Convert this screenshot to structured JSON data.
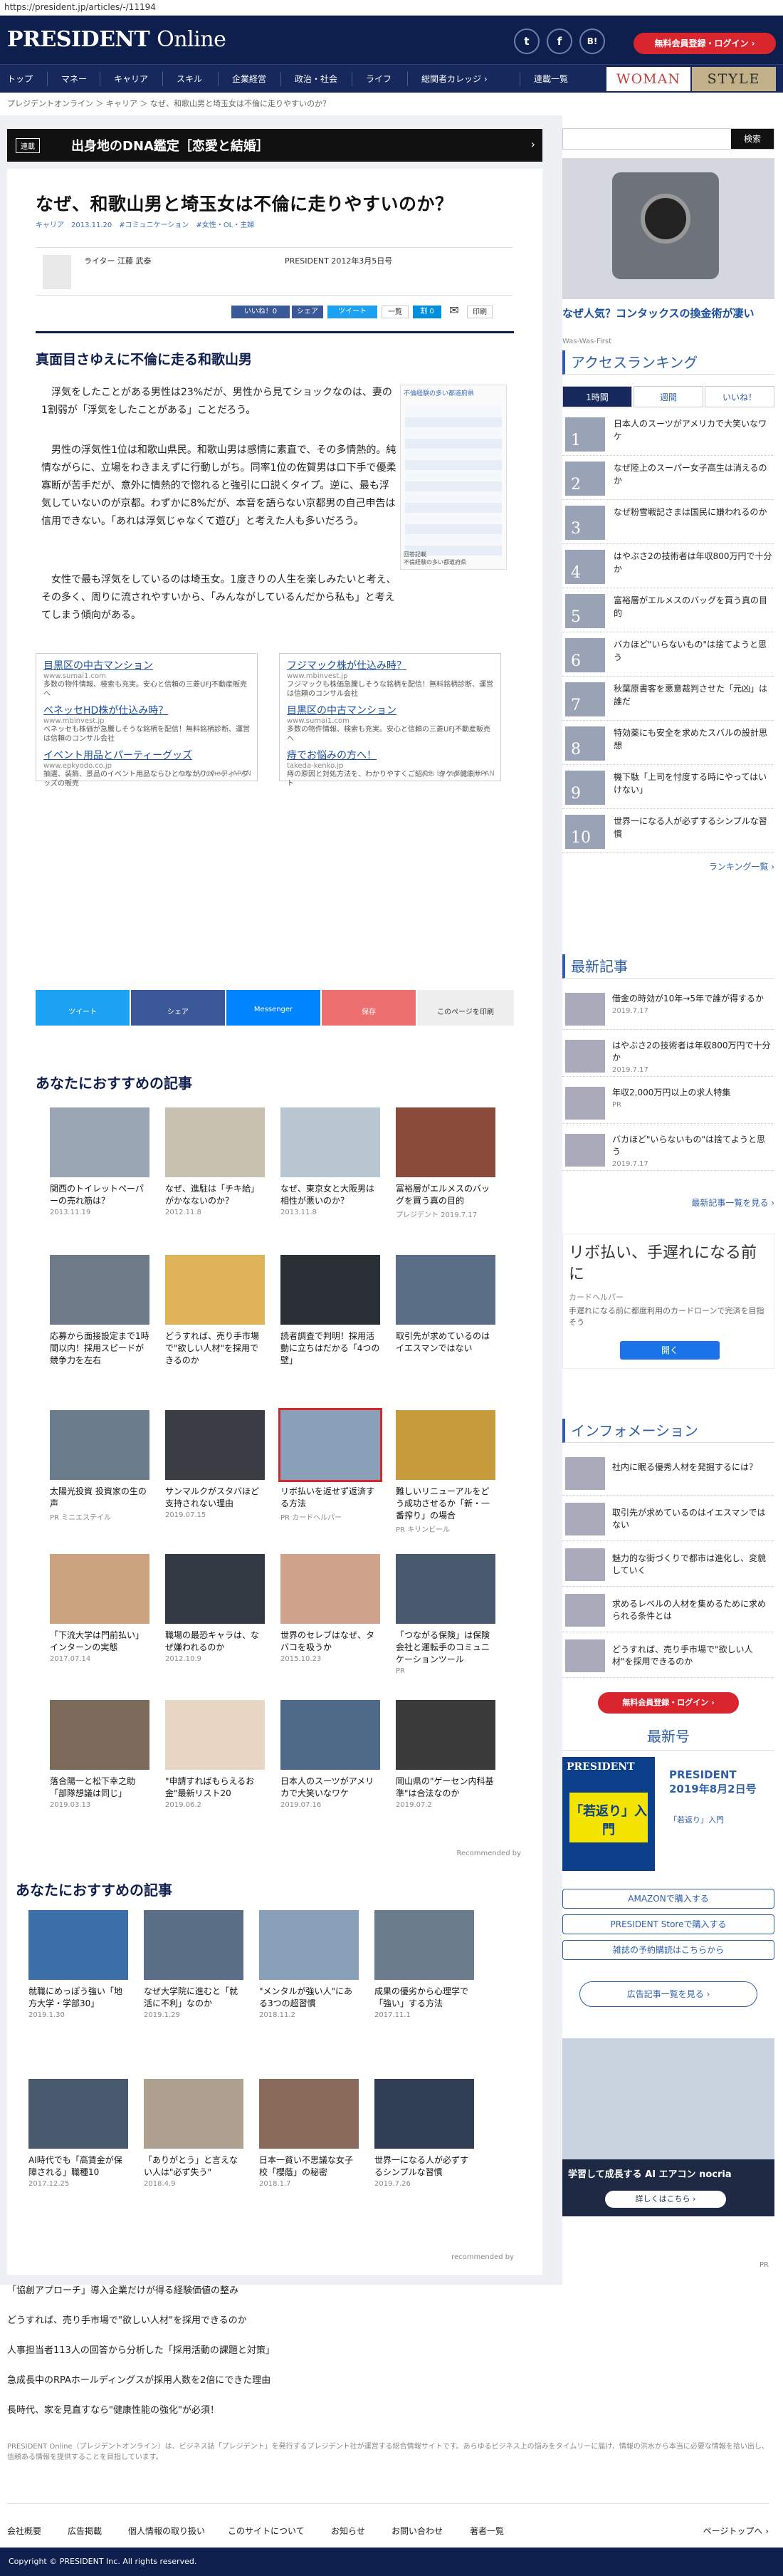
{
  "browser": {
    "url": "https://president.jp/articles/-/11194"
  },
  "header": {
    "logo_bold": "PRESIDENT",
    "logo_light": "Online",
    "social": [
      "t",
      "f",
      "B!"
    ],
    "register_login": "無料会員登録・ログイン ›"
  },
  "nav": {
    "items": [
      "トップ",
      "マネー",
      "キャリア",
      "スキル",
      "企業経営",
      "政治・社会",
      "ライフ",
      "総関者カレッジ ›",
      "連載一覧"
    ],
    "woman": "WOMAN",
    "style": "STYLE"
  },
  "breadcrumb": "プレジデントオンライン ＞ キャリア ＞ なぜ、和歌山男と埼玉女は不倫に走りやすいのか？",
  "article": {
    "series_tag": "連載",
    "series_title": "出身地のDNA鑑定［恋愛と結婚］",
    "title": "なぜ、和歌山男と埼玉女は不倫に走りやすいのか？",
    "meta": "キャリア　2013.11.20　#コミュニケーション　#女性・OL・主婦",
    "author": "ライター 江藤 武泰",
    "pub": "PRESIDENT 2012年3月5日号",
    "shares": [
      "いいね！0",
      "シェア",
      "ツイート",
      "一覧",
      "割 0",
      "✉",
      "印刷"
    ],
    "subhead": "真面目さゆえに不倫に走る和歌山男",
    "paragraphs": [
      "浮気をしたことがある男性は23%だが、男性から見てショックなのは、妻の1割弱が「浮気をしたことがある」ことだろう。",
      "男性の浮気性1位は和歌山県民。和歌山男は感情に素直で、その多情熱的。純情ながらに、立場をわきまえずに行動しがち。同率1位の佐賀男は口下手で優柔寡断が苦手だが、意外に情熱的で惚れると強引に口説くタイプ。逆に、最も浮気していないのが京都。わずかに8%だが、本音を語らない京都男の自己申告は信用できない。「あれは浮気じゃなくて遊び」と考えた人も多いだろう。",
      "女性で最も浮気をしているのは埼玉女。1度きりの人生を楽しみたいと考え、その多く、周りに流されやすいから、「みんながしているんだから私も」と考えてしまう傾向がある。"
    ],
    "figure_title": "不倫経験の多い都道府県",
    "figure_caption": "回答記載\n不倫経験の多い都道府県",
    "ads": [
      {
        "links": [
          "目黒区の中古マンション",
          "ベネッセHD株が仕込み時？",
          "イベント用品とパーティーグッズ"
        ],
        "urls": [
          "www.sumai1.com",
          "www.mbinvest.jp",
          "www.epkyodo.co.jp"
        ],
        "descs": [
          "多数の物件情報、検索も充実。安心と信頼の三菱UFJ不動産販売へ",
          "ベネッセも株価が急騰しそうな銘柄を配信！無料銘柄診断、運営は信頼のコンサル会社",
          "抽選、装飾、景品のイベント用品ならひとつながりパーティーグッズの販売"
        ],
        "foot": "Ads by Yahoo! JAPAN"
      },
      {
        "links": [
          "フジマック株が仕込み時？",
          "目黒区の中古マンション",
          "痔でお悩みの方へ！"
        ],
        "urls": [
          "www.mbinvest.jp",
          "www.sumai1.com",
          "takeda-kenko.jp"
        ],
        "descs": [
          "フジマックも株価急騰しそうな銘柄を配信！無料銘柄診断、運営は信頼のコンサル会社",
          "多数の物件情報、検索も充実。安心と信頼の三菱UFJ不動産販売へ",
          "痔の原因と対処方法を、わかりやすくご紹介！ タケダ健康サイト"
        ],
        "foot": "Ads by Yahoo! JAPAN"
      }
    ],
    "sharebar": [
      "ツイート",
      "シェア",
      "Messenger",
      "保存",
      "このページを印刷"
    ]
  },
  "recommend1": {
    "title": "あなたにおすすめの記事",
    "cards": [
      {
        "t": "関西のトイレットペーパーの売れ筋は？",
        "d": "2013.11.19"
      },
      {
        "t": "なぜ、進駐は「チキ給」がかなないのか？",
        "d": "2012.11.8"
      },
      {
        "t": "なぜ、東京女と大阪男は相性が悪いのか？",
        "d": "2013.11.8"
      },
      {
        "t": "冨裕層がエルメスのバッグを買う真の目的",
        "d": "プレジデント 2019.7.17"
      },
      {
        "t": "応募から面接設定まで1時間以内！採用スピードが競争力を左右",
        "d": ""
      },
      {
        "t": "どうすれば、売り手市場で\"欲しい人材\"を採用できるのか",
        "d": ""
      },
      {
        "t": "読者調査で判明！採用活動に立ちはだかる「4つの壁」",
        "d": ""
      },
      {
        "t": "取引先が求めているのはイエスマンではない",
        "d": ""
      },
      {
        "t": "太陽光投資 投資家の生の声",
        "d": "PR ミニエステイル"
      },
      {
        "t": "サンマルクがスタバほど支持されない理由",
        "d": "2019.07.15"
      },
      {
        "t": "リボ払いを返せず返済する方法",
        "d": "PR カードヘルパー"
      },
      {
        "t": "難しいリニューアルをどう成功させるか「新・一番搾り」の場合",
        "d": "PR キリンビール"
      },
      {
        "t": "「下流大学は門前払い」インターンの実態",
        "d": "2017.07.14"
      },
      {
        "t": "職場の最恐キャラは、なぜ嫌われるのか",
        "d": "2012.10.9"
      },
      {
        "t": "世界のセレブはなぜ、タバコを吸うか",
        "d": "2015.10.23"
      },
      {
        "t": "「つながる保険」は保険会社と運転手のコミュニケーションツール",
        "d": "PR"
      },
      {
        "t": "落合陽一と松下幸之助「部隊想議は同じ」",
        "d": "2019.03.13"
      },
      {
        "t": "\"申請すればもらえるお金\"最新リスト20",
        "d": "2019.06.2"
      },
      {
        "t": "日本人のスーツがアメリカで大笑いなワケ",
        "d": "2019.07.16"
      },
      {
        "t": "岡山県の\"ゲーセン内科基準\"は合法なのか",
        "d": "2019.07.2"
      }
    ],
    "credit": "Recommended by"
  },
  "recommend2": {
    "title": "あなたにおすすめの記事",
    "cards": [
      {
        "t": "就職にめっぽう強い「地方大学・学部30」",
        "d": "2019.1.30"
      },
      {
        "t": "なぜ大学院に進むと「就活に不利」なのか",
        "d": "2019.1.29"
      },
      {
        "t": "\"メンタルが強い人\"にある3つの超習慣",
        "d": "2018.11.2"
      },
      {
        "t": "成果の優劣から心理学で「強い」する方法",
        "d": "2017.11.1"
      },
      {
        "t": "AI時代でも「高賃金が保障される」職種10",
        "d": "2017.12.25"
      },
      {
        "t": "「ありがとう」と言えない人は\"必ず失う\"",
        "d": "2018.4.9"
      },
      {
        "t": "日本一貧い不思議な女子校「櫻蔭」の秘密",
        "d": "2018.1.7"
      },
      {
        "t": "世界一になる人が必ずするシンプルな習慣",
        "d": "2019.7.26"
      }
    ],
    "credit": "recommended by"
  },
  "sidebar": {
    "search_btn": "検索",
    "ad_caption": "なぜ人気？コンタックスの換金術が凄い",
    "ad_source": "Was-Was-First",
    "ranking_title": "アクセスランキング",
    "tabs": [
      "1時間",
      "週間",
      "いいね！"
    ],
    "ranking": [
      "日本人のスーツがアメリカで大笑いなワケ",
      "なぜ陸上のスーパー女子高生は消えるのか",
      "なぜ粉雪戦記さまは国民に嫌われるのか",
      "はやぶさ2の技術者は年収800万円で十分か",
      "富裕層がエルメスのバッグを買う真の目的",
      "バカほど\"いらないもの\"は捨てようと思う",
      "秋葉原書客を悪意裁判させた「元凶」は誰だ",
      "特効薬にも安全を求めたスバルの設計思想",
      "機下駄「上司を忖度する時にやってはいけない」",
      "世界一になる人が必ずするシンプルな習慣"
    ],
    "ranking_more": "ランキング一覧 ›",
    "recent_title": "最新記事",
    "recent": [
      {
        "t": "借金の時効が10年→5年で誰が得するか",
        "d": "2019.7.17"
      },
      {
        "t": "はやぶさ2の技術者は年収800万円で十分か",
        "d": "2019.7.17"
      },
      {
        "t": "年収2,000万円以上の求人特集",
        "d": "PR"
      },
      {
        "t": "バカほど\"いらないもの\"は捨てようと思う",
        "d": "2019.7.17"
      }
    ],
    "recent_more": "最新記事一覧を見る ›",
    "ad2_title": "リボ払い、手遅れになる前に",
    "ad2_sub": "カードヘルパー",
    "ad2_desc": "手遅れになる前に都度利用のカードローンで完済を目指そう",
    "ad2_btn": "開く",
    "info_title": "インフォメーション",
    "info": [
      "社内に眠る優秀人材を発掘するには？",
      "取引先が求めているのはイエスマンではない",
      "魅力的な街づくりで都市は進化し、変貌していく",
      "求めるレベルの人材を集めるために求められる条件とは",
      "どうすれば、売り手市場で\"欲しい人材\"を採用できるのか"
    ],
    "register_login": "無料会員登録・ログイン ›",
    "issue_title": "最新号",
    "mag_title": "PRESIDENT 2019年8月2日号",
    "mag_sub": "「若返り」入門",
    "mag_cover": "「若返り」入門",
    "buy_buttons": [
      "AMAZONで購入する",
      "PRESIDENT Storeで購入する",
      "雑誌の予約購読はこちらから"
    ],
    "ad_list_btn": "広告記事一覧を見る ›",
    "bottom_ad": "学習して成長する AI エアコン nocria",
    "bottom_ad_btn": "詳しくはこちら ›"
  },
  "footer_links": [
    "「協創アプローチ」導入企業だけが得る経験価値の整み",
    "どうすれば、売り手市場で\"欲しい人材\"を採用できるのか",
    "人事担当者113人の回答から分析した「採用活動の課題と対策」",
    "急成長中のRPAホールディングスが採用人数を2倍にできた理由",
    "長時代、家を見直すなら\"健康性能の強化\"が必須！"
  ],
  "footer_pr": "PR",
  "footer_note": "PRESIDENT Online（プレジデントオンライン）は、ビジネス誌「プレジデント」を発行するプレジデント社が運営する総合情報サイトです。あらゆるビジネス上の悩みをタイムリーに届け、情報の洪水から本当に必要な情報を拾い出し、信頼ある情報を提供することを目指しています。",
  "bottom_nav": [
    "会社概要",
    "広告掲載",
    "個人情報の取り扱い",
    "このサイトについて",
    "お知らせ",
    "お問い合わせ",
    "著者一覧"
  ],
  "page_top": "ページトップへ ›",
  "copyright": "Copyright © PRESIDENT Inc. All rights reserved."
}
